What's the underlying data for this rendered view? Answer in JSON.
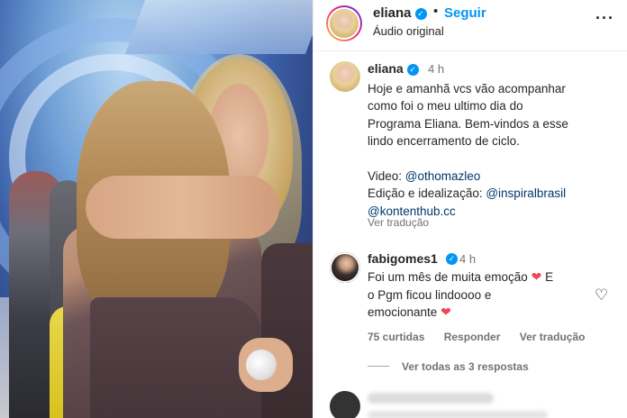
{
  "header": {
    "username": "eliana",
    "separator": "•",
    "follow_label": "Seguir",
    "audio_label": "Áudio original",
    "more_icon": "more-icon"
  },
  "caption": {
    "username": "eliana",
    "time": "4 h",
    "line1": "Hoje e amanhã vcs vão acompanhar",
    "line2": "como foi o meu ultimo dia do",
    "line3": "Programa Eliana. Bem-vindos a esse",
    "line4": "lindo encerramento de ciclo.",
    "video_label": "Video: ",
    "video_link": "@othomazleo",
    "edit_label": "Edição e idealização: ",
    "edit_link1": "@inspiralbrasil",
    "edit_link2": "@kontenthub.cc",
    "translate": "Ver tradução"
  },
  "comment": {
    "username": "fabigomes1",
    "time": "4 h",
    "line1": "Foi um mês de muita emoção",
    "line1_end": " E",
    "line2": "o Pgm ficou lindoooo e",
    "line3": "emocionante",
    "likes": "75 curtidas",
    "reply": "Responder",
    "translate": "Ver tradução",
    "view_replies": "Ver todas as 3 respostas"
  },
  "colors": {
    "accent": "#0095f6",
    "link": "#00376b",
    "heart": "#ed4956",
    "muted": "#737373"
  }
}
